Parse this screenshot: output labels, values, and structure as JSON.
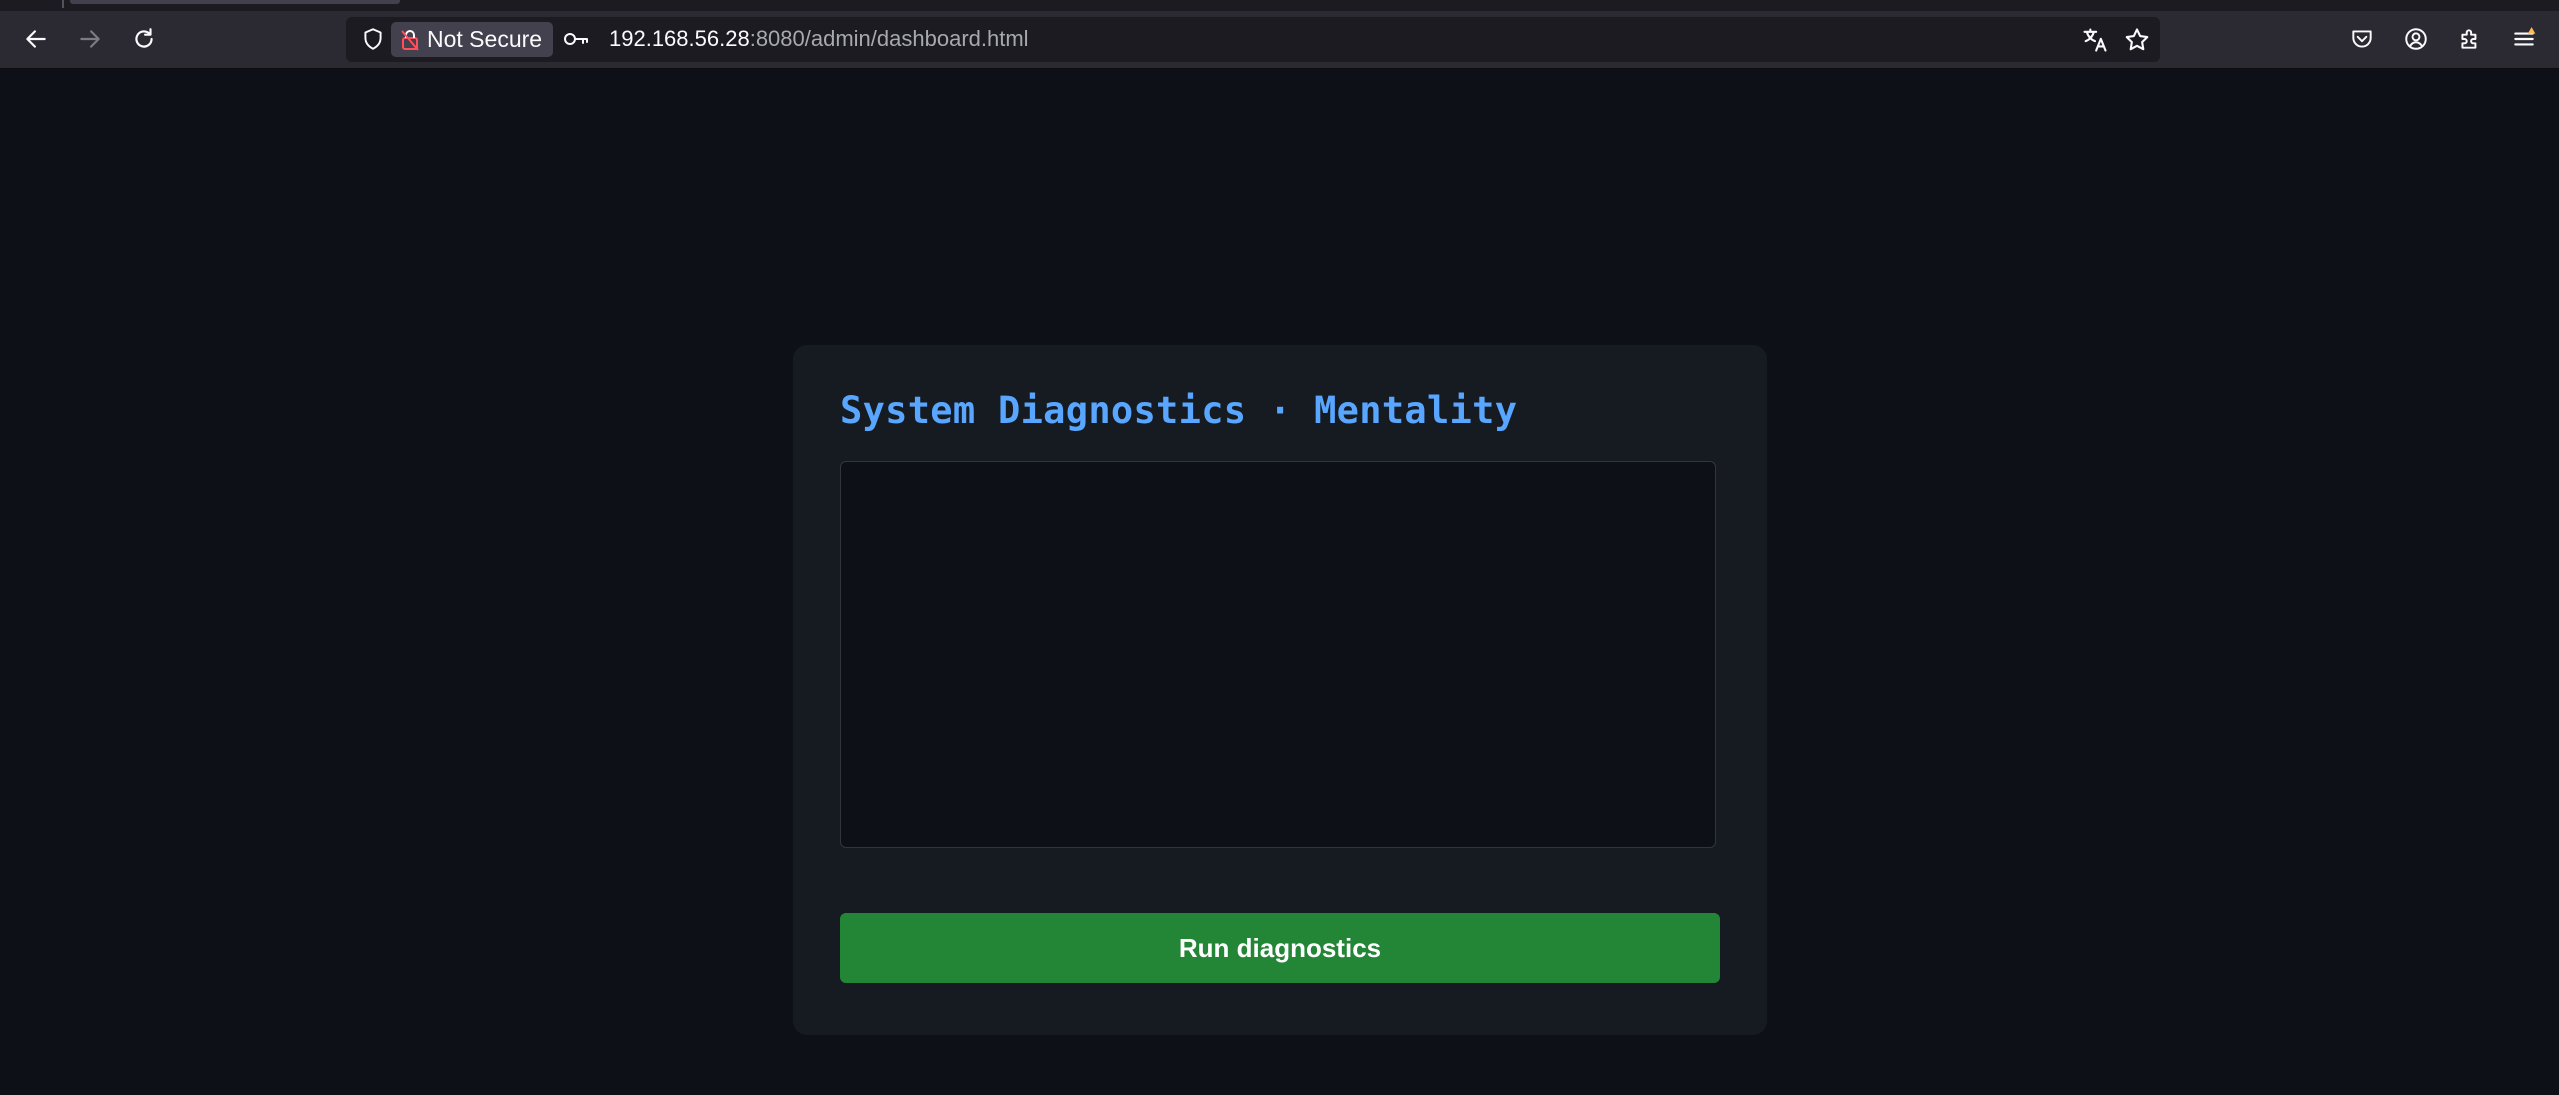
{
  "browser": {
    "security_label": "Not Secure",
    "url_host": "192.168.56.28",
    "url_rest": ":8080/admin/dashboard.html",
    "icons": {
      "back": "back-arrow-icon",
      "forward": "forward-arrow-icon",
      "reload": "reload-icon",
      "tracking_protection": "shield-icon",
      "insecure_lock": "insecure-lock-icon",
      "permissions": "key-icon",
      "translate": "translate-icon",
      "bookmark": "star-icon",
      "pocket": "pocket-icon",
      "account": "account-icon",
      "extensions": "puzzle-icon",
      "menu": "hamburger-menu-icon"
    }
  },
  "page": {
    "title": "System Diagnostics · Mentality",
    "output_text": "",
    "run_button_label": "Run diagnostics"
  },
  "colors": {
    "page_background": "#0d1117",
    "card_background": "#161b22",
    "title_color": "#58a6ff",
    "button_background": "#238636"
  }
}
